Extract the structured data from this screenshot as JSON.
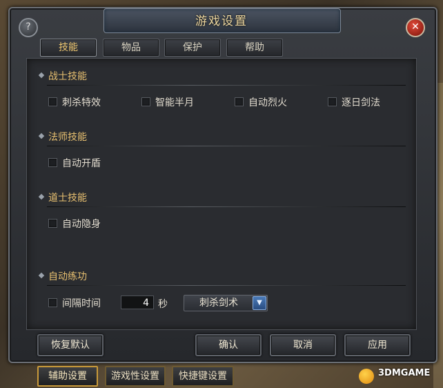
{
  "window": {
    "title": "游戏设置"
  },
  "icons": {
    "help": "?",
    "close": "✕",
    "dropdown_arrow": "▼"
  },
  "tabs": [
    {
      "label": "技能",
      "active": true
    },
    {
      "label": "物品",
      "active": false
    },
    {
      "label": "保护",
      "active": false
    },
    {
      "label": "帮助",
      "active": false
    }
  ],
  "sections": {
    "warrior": {
      "title": "战士技能",
      "options": [
        {
          "label": "刺杀特效",
          "checked": false
        },
        {
          "label": "智能半月",
          "checked": false
        },
        {
          "label": "自动烈火",
          "checked": false
        },
        {
          "label": "逐日剑法",
          "checked": false
        }
      ]
    },
    "mage": {
      "title": "法师技能",
      "options": [
        {
          "label": "自动开盾",
          "checked": false
        }
      ]
    },
    "taoist": {
      "title": "道士技能",
      "options": [
        {
          "label": "自动隐身",
          "checked": false
        }
      ]
    },
    "practice": {
      "title": "自动练功",
      "interval_label": "间隔时间",
      "interval_checked": false,
      "interval_value": "4",
      "unit": "秒",
      "skill_selected": "刺杀剑术"
    }
  },
  "buttons": {
    "restore": "恢复默认",
    "confirm": "确认",
    "cancel": "取消",
    "apply": "应用"
  },
  "bottom_tabs": [
    {
      "label": "辅助设置",
      "active": true
    },
    {
      "label": "游戏性设置",
      "active": false
    },
    {
      "label": "快捷键设置",
      "active": false
    }
  ],
  "watermark": "3DMGAME"
}
